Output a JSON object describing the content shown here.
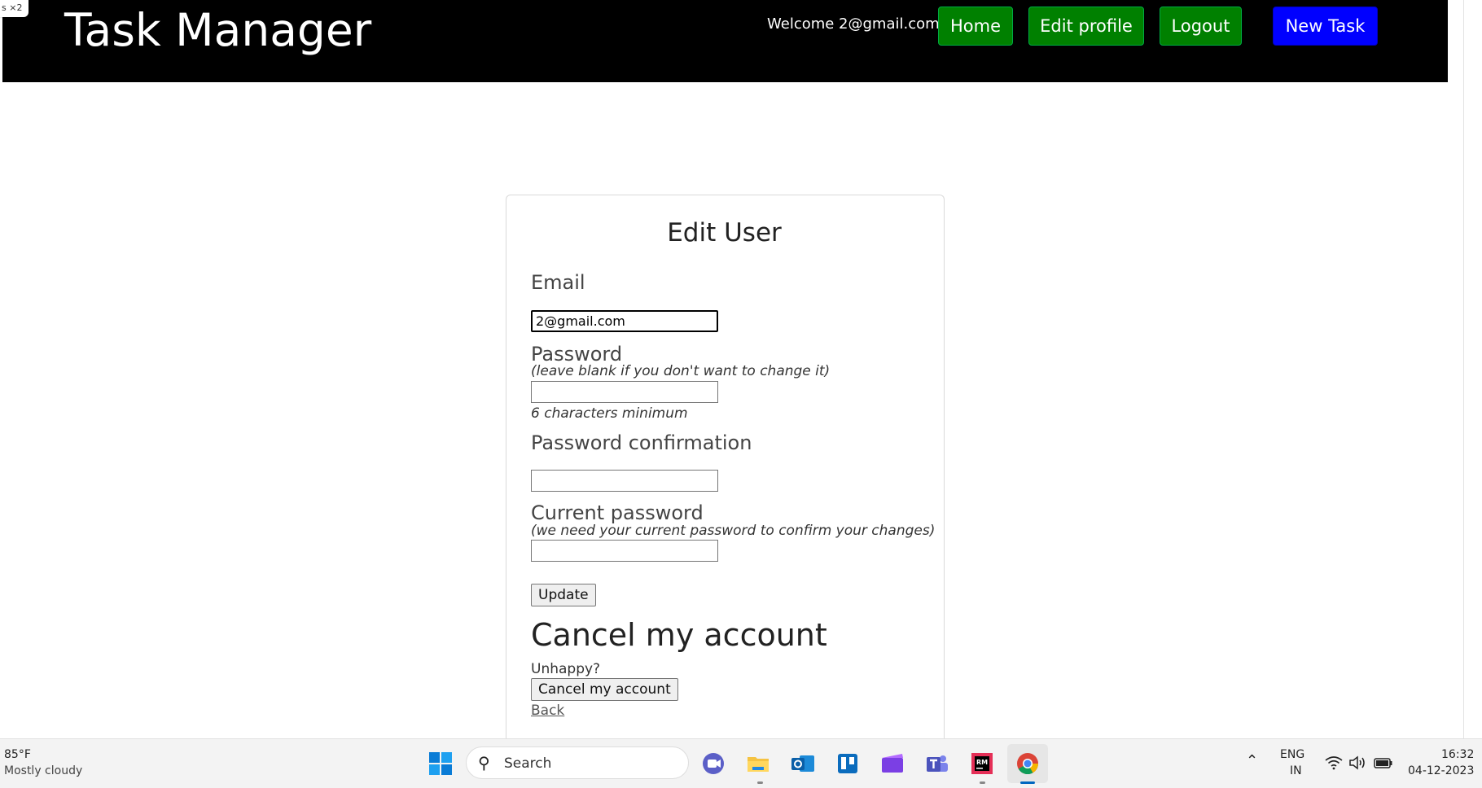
{
  "corner_badge": "s  ×2",
  "navbar": {
    "brand": "Task Manager",
    "welcome": "Welcome 2@gmail.com",
    "home_label": "Home",
    "edit_profile_label": "Edit profile",
    "logout_label": "Logout",
    "new_task_label": "New Task",
    "colors": {
      "bar": "#000000",
      "green_button": "#008000",
      "blue_button": "#0000ff"
    }
  },
  "form": {
    "title": "Edit User",
    "email_label": "Email",
    "email_value": "2@gmail.com",
    "password_label": "Password",
    "password_hint": "(leave blank if you don't want to change it)",
    "password_min": "6 characters minimum",
    "password_confirmation_label": "Password confirmation",
    "current_password_label": "Current password",
    "current_password_hint": "(we need your current password to confirm your changes)",
    "update_label": "Update"
  },
  "cancel_section": {
    "heading": "Cancel my account",
    "unhappy": "Unhappy?",
    "cancel_button": "Cancel my account",
    "back_link": "Back"
  },
  "taskbar": {
    "temperature": "85°F",
    "weather": "Mostly cloudy",
    "search_placeholder": "Search",
    "language_top": "ENG",
    "language_bottom": "IN",
    "time": "16:32",
    "date": "04-12-2023",
    "apps": [
      "start-icon",
      "meet-icon",
      "file-explorer-icon",
      "outlook-icon",
      "trello-icon",
      "clipchamp-icon",
      "teams-icon",
      "rubymine-icon",
      "chrome-icon"
    ]
  }
}
